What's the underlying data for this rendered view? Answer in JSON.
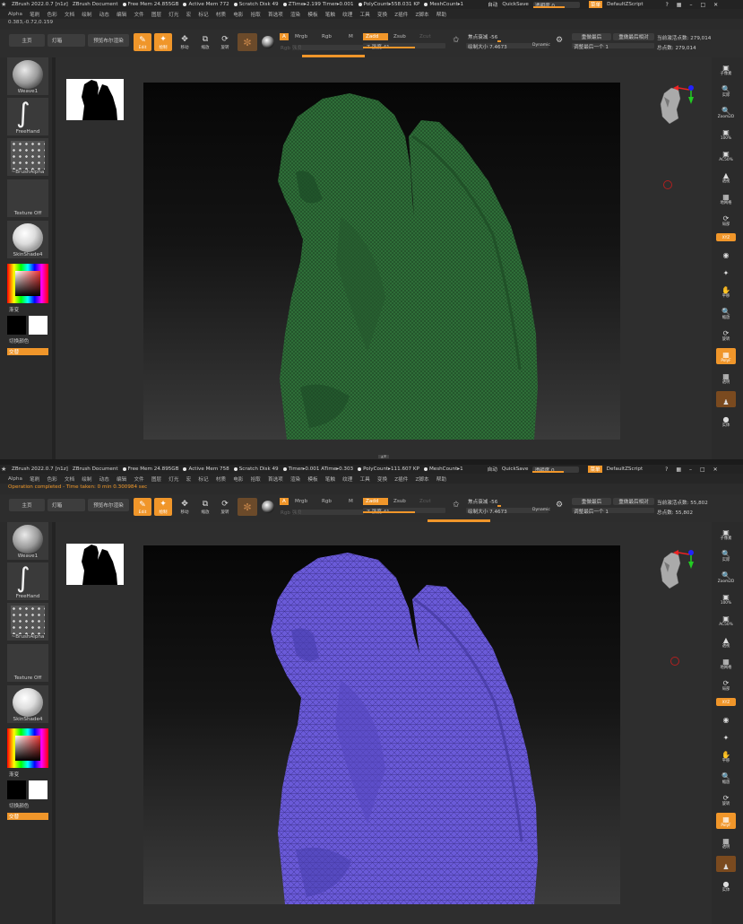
{
  "colors": {
    "accent": "#f0962a",
    "mesh_top": "#2f7a3c",
    "mesh_bottom": "#6a5ad8"
  },
  "top": {
    "title_bar": {
      "app": "ZBrush 2022.0.7 [n1z]",
      "doc": "ZBrush Document",
      "free_mem": "Free Mem 24.855GB",
      "active_mem": "Active Mem 772",
      "scratch": "Scratch Disk 49",
      "timers": "ZTime▸2.199 Timer▸0.001",
      "polycount": "PolyCount▸558.031 KP",
      "meshcount": "MeshCount▸1",
      "quicksave_label": "自动",
      "quicksave": "QuickSave",
      "transparency": "透明度 0",
      "menus": "菜单",
      "script": "DefaultZScript"
    },
    "status": "0.383,-0.72,0.159",
    "status_orange": false,
    "right_stats": {
      "active": "当前激活点数: 279,014",
      "total": "总点数: 279,014"
    },
    "zadd": "Zadd",
    "zsub": "Zsub",
    "zcut": "Zcut",
    "rgb_intensity": "Rgb 强度",
    "z_intensity": "Z 强度 41",
    "focal_shift": "焦点衰减 -56",
    "draw_size": "绘制大小 7.4673",
    "redo": "重做最后",
    "redo_rel": "重做最后相对",
    "adjust": "调整最后一个 1"
  },
  "bottom": {
    "title_bar": {
      "app": "ZBrush 2022.0.7 [n1z]",
      "doc": "ZBrush Document",
      "free_mem": "Free Mem 24.895GB",
      "active_mem": "Active Mem 758",
      "scratch": "Scratch Disk 49",
      "timers": "Timer▸0.001 ATime▸0.303",
      "polycount": "PolyCount▸111.607 KP",
      "meshcount": "MeshCount▸1",
      "quicksave_label": "自动",
      "quicksave": "QuickSave",
      "transparency": "透明度 0",
      "menus": "菜单",
      "script": "DefaultZScript"
    },
    "status": "Operation completed - Time taken: 0 min 0.300984 sec",
    "status_orange": true,
    "right_stats": {
      "active": "当前激活点数: 55,802",
      "total": "总点数: 55,802"
    },
    "zadd": "Zadd",
    "zsub": "Zsub",
    "zcut": "Zcut",
    "rgb_intensity": "Rgb 强度",
    "z_intensity": "Z 强度 41",
    "focal_shift": "焦点衰减 -56",
    "draw_size": "绘制大小 7.4673",
    "redo": "重做最后",
    "redo_rel": "重做最后相对",
    "adjust": "调整最后一个 1"
  },
  "menubar": [
    "Alpha",
    "笔刷",
    "色彩",
    "文档",
    "绘制",
    "动态",
    "编辑",
    "文件",
    "图层",
    "灯光",
    "宏",
    "标记",
    "材质",
    "电影",
    "拾取",
    "首选项",
    "渲染",
    "模板",
    "笔触",
    "纹理",
    "工具",
    "变换",
    "Z插件",
    "Z脚本",
    "帮助"
  ],
  "toolbar": {
    "home": "主页",
    "lightbox": "灯箱",
    "preview": "预览布尔渲染",
    "edit": "Edit",
    "draw": "绘制",
    "move": "移动",
    "scale": "缩放",
    "rotate": "旋转",
    "a": "A",
    "mrgb": "Mrgb",
    "rgb": "Rgb",
    "m": "M",
    "dynamic": "Dynamic"
  },
  "left": {
    "brush": "Weave1",
    "stroke": "FreeHand",
    "alpha": "~BrushAlpha",
    "texture": "Texture Off",
    "material": "SkinShade4",
    "gradient": "渐变",
    "switch_color": "切换颜色",
    "alternate": "交替"
  },
  "right": [
    "子像素",
    "实际",
    "Zoom2D",
    "100%",
    "AC50%",
    "透视",
    "地网格",
    "XYZ",
    "局部",
    "平移",
    "缩放",
    "旋转",
    "PolyF",
    "透明",
    "实体"
  ]
}
